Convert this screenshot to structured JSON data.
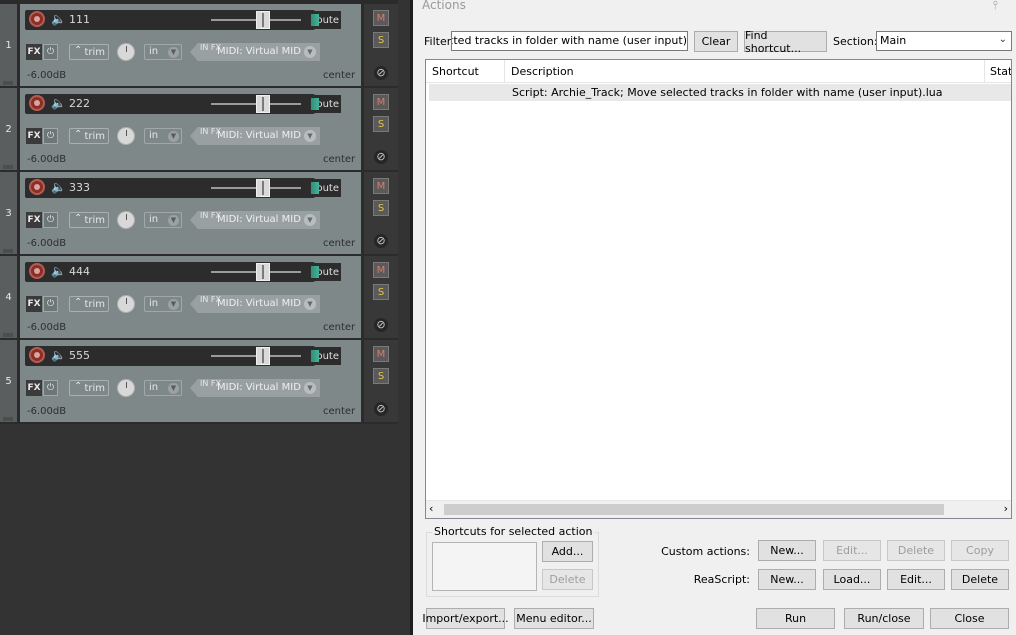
{
  "tracks": [
    {
      "number": "1",
      "name": "111",
      "route": "Route",
      "fx": "FX",
      "trim": "trim",
      "input": "in",
      "infx": "IN FX",
      "midi": "MIDI: Virtual MID",
      "volume": "-6.00dB",
      "pan": "center",
      "mute": "M",
      "solo": "S"
    },
    {
      "number": "2",
      "name": "222",
      "route": "Route",
      "fx": "FX",
      "trim": "trim",
      "input": "in",
      "infx": "IN FX",
      "midi": "MIDI: Virtual MID",
      "volume": "-6.00dB",
      "pan": "center",
      "mute": "M",
      "solo": "S"
    },
    {
      "number": "3",
      "name": "333",
      "route": "Route",
      "fx": "FX",
      "trim": "trim",
      "input": "in",
      "infx": "IN FX",
      "midi": "MIDI: Virtual MID",
      "volume": "-6.00dB",
      "pan": "center",
      "mute": "M",
      "solo": "S"
    },
    {
      "number": "4",
      "name": "444",
      "route": "Route",
      "fx": "FX",
      "trim": "trim",
      "input": "in",
      "infx": "IN FX",
      "midi": "MIDI: Virtual MID",
      "volume": "-6.00dB",
      "pan": "center",
      "mute": "M",
      "solo": "S"
    },
    {
      "number": "5",
      "name": "555",
      "route": "Route",
      "fx": "FX",
      "trim": "trim",
      "input": "in",
      "infx": "IN FX",
      "midi": "MIDI: Virtual MID",
      "volume": "-6.00dB",
      "pan": "center",
      "mute": "M",
      "solo": "S"
    }
  ],
  "actions": {
    "title": "Actions",
    "filter_label": "Filter:",
    "filter_value": "Move selected tracks in folder with name (user input)",
    "clear_label": "Clear",
    "find_shortcut_label": "Find shortcut...",
    "section_label": "Section:",
    "section_value": "Main",
    "columns": {
      "shortcut": "Shortcut",
      "description": "Description",
      "state": "State"
    },
    "rows": [
      {
        "shortcut": "",
        "description": "Script: Archie_Track;  Move selected tracks in folder with name (user input).lua"
      }
    ],
    "shortcuts_group_label": "Shortcuts for selected action",
    "add_label": "Add...",
    "delete_shortcut_label": "Delete",
    "custom_actions_label": "Custom actions:",
    "custom_new": "New...",
    "custom_edit": "Edit...",
    "custom_delete": "Delete",
    "custom_copy": "Copy",
    "reascript_label": "ReaScript:",
    "reascript_new": "New...",
    "reascript_load": "Load...",
    "reascript_edit": "Edit...",
    "reascript_delete": "Delete",
    "import_export": "Import/export...",
    "menu_editor": "Menu editor...",
    "run": "Run",
    "run_close": "Run/close",
    "close": "Close"
  },
  "colors": {
    "track_panel": "#7e8889",
    "window_bg": "#f0f0f0",
    "record_arm": "#8a2f27",
    "route_accent": "#48b097"
  },
  "icons": {
    "record": "record-arm-icon",
    "speaker": "speaker-icon",
    "phase": "phase-invert-icon",
    "pin": "pin-icon",
    "dropdown": "chevron-down-icon"
  }
}
